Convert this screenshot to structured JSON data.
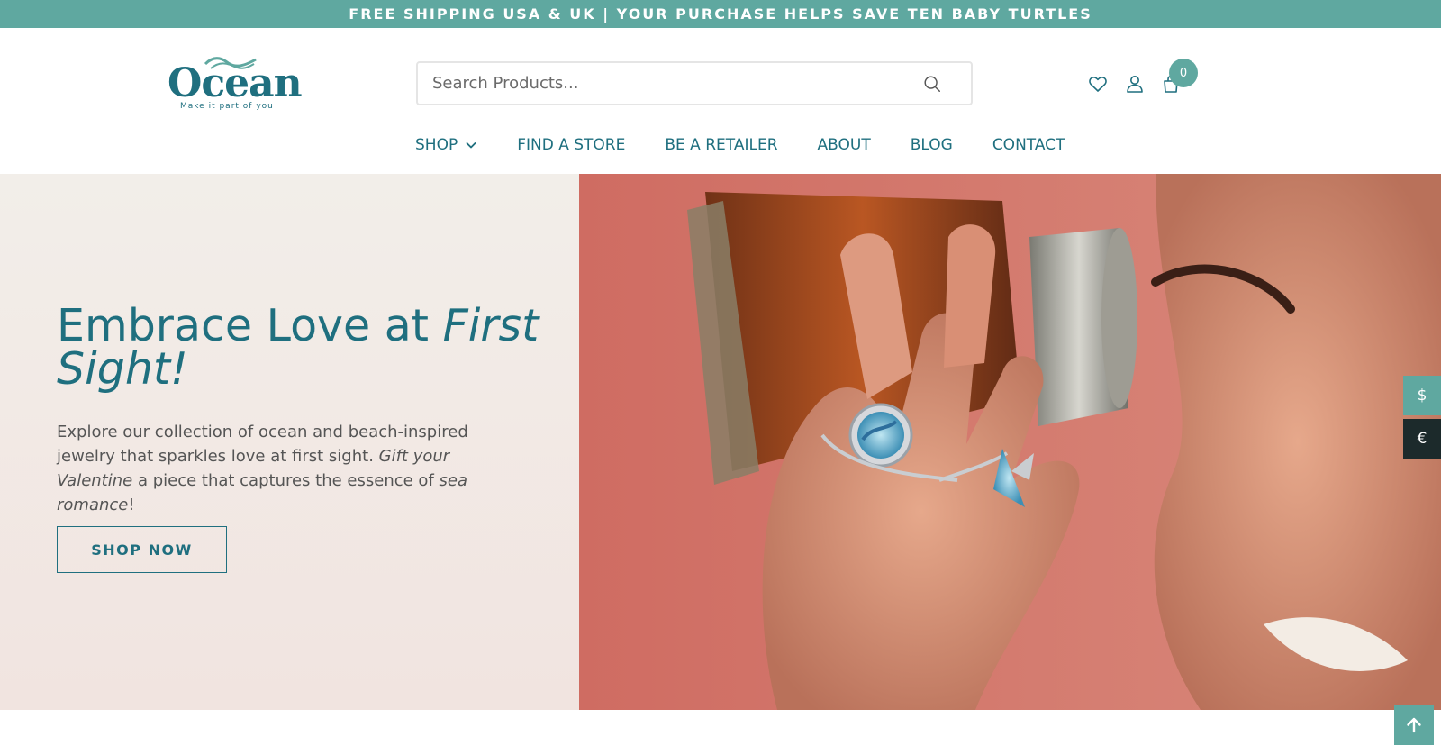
{
  "announcement": {
    "text": "FREE SHIPPING USA & UK | YOUR PURCHASE HELPS SAVE TEN BABY TURTLES",
    "background": "#5fa8a0"
  },
  "brand": {
    "name": "Ocean",
    "tagline": "Make it part of you",
    "color": "#1f6f7f"
  },
  "search": {
    "placeholder": "Search Products...",
    "icon": "search-icon"
  },
  "header_icons": {
    "wishlist": "heart-icon",
    "account": "user-icon",
    "cart": "shopping-bag-icon",
    "cart_count": "0"
  },
  "nav": {
    "items": [
      {
        "label": "SHOP",
        "has_dropdown": true
      },
      {
        "label": "FIND A STORE"
      },
      {
        "label": "BE A RETAILER"
      },
      {
        "label": "ABOUT"
      },
      {
        "label": "BLOG"
      },
      {
        "label": "CONTACT"
      }
    ]
  },
  "hero": {
    "title_plain": "Embrace Love at ",
    "title_italic": "First Sight!",
    "text_1": "Explore our collection of ocean and beach-inspired jewelry that sparkles love at first sight. ",
    "text_italic_1": "Gift your Valentine",
    "text_2": " a piece that captures the essence of ",
    "text_italic_2": "sea romance",
    "text_3": "!",
    "cta_label": "SHOP NOW"
  },
  "currency": {
    "usd": "$",
    "eur": "€"
  },
  "colors": {
    "teal": "#5fa8a0",
    "dark_teal": "#1f6f7f",
    "hero_bg": "#f1e4e0",
    "photo_bg": "#d77a6e"
  }
}
